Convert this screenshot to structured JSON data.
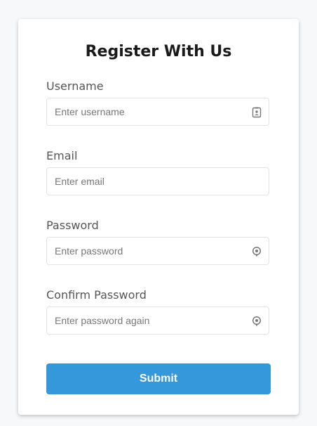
{
  "form": {
    "title": "Register With Us",
    "fields": [
      {
        "label": "Username",
        "placeholder": "Enter username",
        "icon": "contact-card-icon"
      },
      {
        "label": "Email",
        "placeholder": "Enter email",
        "icon": ""
      },
      {
        "label": "Password",
        "placeholder": "Enter password",
        "icon": "password-reveal-icon"
      },
      {
        "label": "Confirm Password",
        "placeholder": "Enter password again",
        "icon": "password-reveal-icon"
      }
    ],
    "submit_label": "Submit"
  },
  "colors": {
    "accent": "#3498db",
    "background": "#f7f8fa",
    "card": "#ffffff",
    "label": "#555555",
    "border": "#e3e3e3"
  }
}
